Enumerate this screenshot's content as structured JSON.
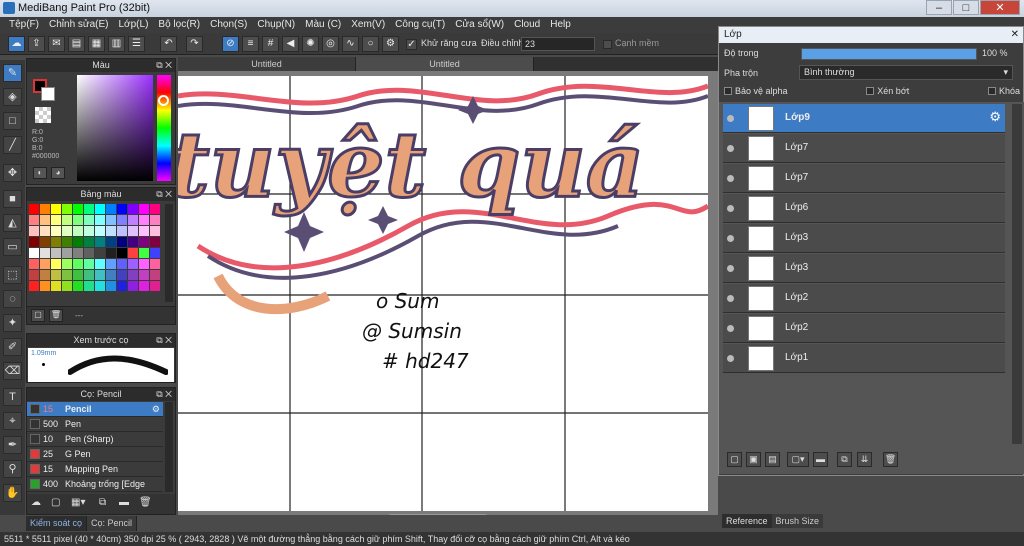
{
  "window": {
    "title": "MediBang Paint Pro (32bit)",
    "min": "–",
    "max": "□",
    "close": "✕"
  },
  "menu": [
    "Tệp(F)",
    "Chỉnh sửa(E)",
    "Lớp(L)",
    "Bộ lọc(R)",
    "Chọn(S)",
    "Chụp(N)",
    "Màu (C)",
    "Xem(V)",
    "Công cụ(T)",
    "Cửa sổ(W)",
    "Cloud",
    "Help"
  ],
  "toolbar": {
    "antialias_label": "Khử răng cưa",
    "correction_label": "Điều chỉnh",
    "correction_value": "23",
    "snap_label": "Cạnh mềm"
  },
  "tabs": [
    "Untitled",
    "Untitled"
  ],
  "color_panel": {
    "title": "Màu",
    "r": "R:0",
    "g": "G:0",
    "b": "B:0",
    "hex": "#000000"
  },
  "palette_panel": {
    "title": "Bảng màu",
    "colors": [
      "#ff0000",
      "#ff8000",
      "#ffff00",
      "#80ff00",
      "#00ff00",
      "#00ff80",
      "#00ffff",
      "#0080ff",
      "#0000ff",
      "#8000ff",
      "#ff00ff",
      "#ff0080",
      "#ff8080",
      "#ffc080",
      "#ffff80",
      "#c0ff80",
      "#80ff80",
      "#80ffc0",
      "#80ffff",
      "#80c0ff",
      "#8080ff",
      "#c080ff",
      "#ff80ff",
      "#ff80c0",
      "#ffc0c0",
      "#ffe0c0",
      "#ffffc0",
      "#e0ffc0",
      "#c0ffc0",
      "#c0ffe0",
      "#c0ffff",
      "#c0e0ff",
      "#c0c0ff",
      "#e0c0ff",
      "#ffc0ff",
      "#ffc0e0",
      "#800000",
      "#804000",
      "#808000",
      "#408000",
      "#008000",
      "#008040",
      "#008080",
      "#004080",
      "#000080",
      "#400080",
      "#800080",
      "#800040",
      "#ffffff",
      "#e0e0e0",
      "#c0c0c0",
      "#a0a0a0",
      "#808080",
      "#606060",
      "#404040",
      "#202020",
      "#000000",
      "#ff4040",
      "#40ff40",
      "#4040ff",
      "#ff6060",
      "#ffa060",
      "#ffff60",
      "#a0ff60",
      "#60ff60",
      "#60ffa0",
      "#60ffff",
      "#60a0ff",
      "#6060ff",
      "#a060ff",
      "#ff60ff",
      "#ff60a0",
      "#c04040",
      "#c08040",
      "#c0c040",
      "#80c040",
      "#40c040",
      "#40c080",
      "#40c0c0",
      "#4080c0",
      "#4040c0",
      "#8040c0",
      "#c040c0",
      "#c04080",
      "#ff2020",
      "#ff9020",
      "#e0e020",
      "#90e020",
      "#20e020",
      "#20e090",
      "#20e0e0",
      "#2090e0",
      "#2020e0",
      "#9020e0",
      "#e020e0",
      "#e02090"
    ],
    "footer": "---"
  },
  "preview_panel": {
    "title": "Xem trước cọ",
    "size": "1.09mm"
  },
  "brush_panel": {
    "title": "Cọ: Pencil",
    "brushes": [
      {
        "size": "15",
        "name": "Pencil",
        "color": "#333333"
      },
      {
        "size": "500",
        "name": "Pen",
        "color": "#333333"
      },
      {
        "size": "10",
        "name": "Pen (Sharp)",
        "color": "#333333"
      },
      {
        "size": "25",
        "name": "G Pen",
        "color": "#e23a3a"
      },
      {
        "size": "15",
        "name": "Mapping Pen",
        "color": "#e23a3a"
      },
      {
        "size": "400",
        "name": "Khoảng trống [Edge",
        "color": "#2aa12a"
      }
    ]
  },
  "bottom_tabs": [
    "Kiểm soát cọ",
    "Cọ: Pencil"
  ],
  "canvas": {
    "title_text": "tuyệt quá",
    "signature": [
      "o Sum",
      "@ Sumsin",
      "# hd247"
    ]
  },
  "layer_panel": {
    "title": "Lớp",
    "opacity_label": "Độ trong",
    "opacity_value": "100 %",
    "opacity_fraction": 1.0,
    "blend_label": "Pha trộn",
    "blend_value": "Bình thường",
    "protect_alpha": "Bảo vệ alpha",
    "clipping": "Xén bớt",
    "lock": "Khóa",
    "layers": [
      "Lớp9",
      "Lớp7",
      "Lớp7",
      "Lớp6",
      "Lớp3",
      "Lớp3",
      "Lớp2",
      "Lớp2",
      "Lớp1"
    ],
    "tabs": [
      "Reference",
      "Brush Size"
    ]
  },
  "status": "5511 * 5511 pixel   (40 * 40cm)   350 dpi   25 %   ( 2943, 2828 )   Vẽ một đường thẳng bằng cách giữ phím Shift, Thay đổi cỡ cọ bằng cách giữ phím Ctrl, Alt và kéo"
}
